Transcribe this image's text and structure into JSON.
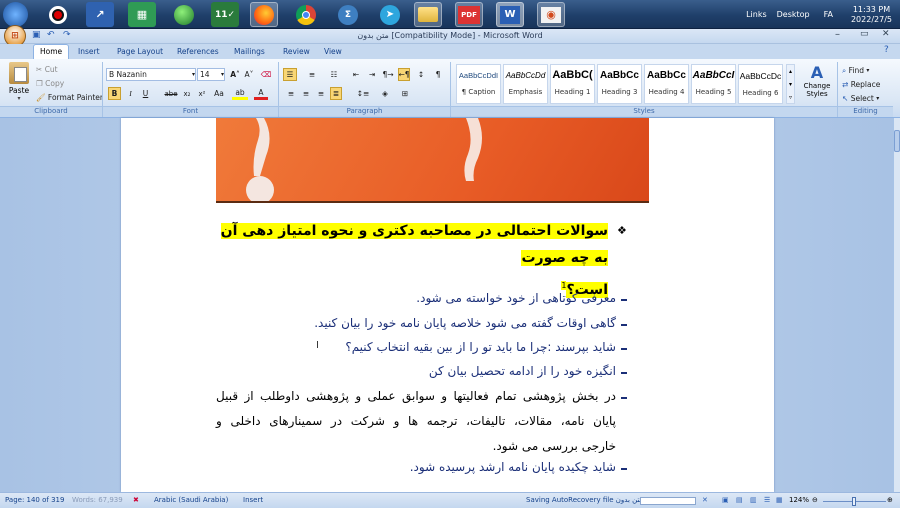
{
  "taskbar": {
    "icons": [
      "start-orb",
      "record-app",
      "chart-app",
      "spreadsheet-app",
      "network-app",
      "calendar-app",
      "firefox",
      "chrome",
      "math-app",
      "telegram",
      "folder",
      "pdf-app",
      "word-app",
      "image-app"
    ],
    "pdf_label": "PDF",
    "tray_links": "Links",
    "tray_desktop": "Desktop",
    "tray_lang": "FA",
    "time": "11:33 PM",
    "date": "2022/27/5"
  },
  "window": {
    "title": "متن بدون [Compatibility Mode] - Microsoft Word"
  },
  "ribbon": {
    "tabs": [
      "Home",
      "Insert",
      "Page Layout",
      "References",
      "Mailings",
      "Review",
      "View"
    ],
    "clipboard": {
      "paste": "Paste",
      "cut": "Cut",
      "copy": "Copy",
      "format_painter": "Format Painter",
      "label": "Clipboard"
    },
    "font": {
      "name": "B Nazanin",
      "size": "14",
      "label": "Font",
      "bold": "B",
      "italic": "I",
      "underline": "U",
      "strike": "abe"
    },
    "paragraph": {
      "label": "Paragraph"
    },
    "styles": {
      "label": "Styles",
      "items": [
        {
          "sample": "AaBbCcDdI",
          "name": "¶ Caption"
        },
        {
          "sample": "AaBbCcDd",
          "name": "Emphasis"
        },
        {
          "sample": "AaBbC(",
          "name": "Heading 1"
        },
        {
          "sample": "AaBbCc",
          "name": "Heading 3"
        },
        {
          "sample": "AaBbCc",
          "name": "Heading 4"
        },
        {
          "sample": "AaBbCcI",
          "name": "Heading 5"
        },
        {
          "sample": "AaBbCcDc",
          "name": "Heading 6"
        }
      ],
      "change_styles": "Change Styles"
    },
    "editing": {
      "find": "Find",
      "replace": "Replace",
      "select": "Select",
      "label": "Editing"
    }
  },
  "document": {
    "heading_line1": "سوالات احتمالی در مصاحبه دکتری و نحوه امتیاز دهی آن به چه صورت",
    "heading_line2": "است؟",
    "heading_ref": "1",
    "bullets": [
      "معرفی کوتاهی از خود خواسته می شود.",
      "گاهی اوقات گفته می شود خلاصه پایان نامه خود را بیان کنید.",
      "شاید بپرسند :چرا ما باید تو را از بین بقیه انتخاب کنیم؟",
      "انگیزه خود را از ادامه تحصیل بیان کن"
    ],
    "bullet5_line1": "در بخش پژوهشی تمام فعالیتها و سوابق عملی و پژوهشی داوطلب از قبیل",
    "bullet5_line2": "پایان نامه، مقالات، تالیفات، ترجمه ها و شرکت در سمینارهای داخلی و",
    "bullet5_line3": "خارجی بررسی می شود.",
    "bullet6": "شاید چکیده پایان نامه ارشد پرسیده شود."
  },
  "status": {
    "page": "Page: 140 of 319",
    "words": "Words: 67,939",
    "lang": "Arabic (Saudi Arabia)",
    "insert": "Insert",
    "autorecovery": "Saving AutoRecovery file متن بدون...",
    "zoom": "124%"
  }
}
